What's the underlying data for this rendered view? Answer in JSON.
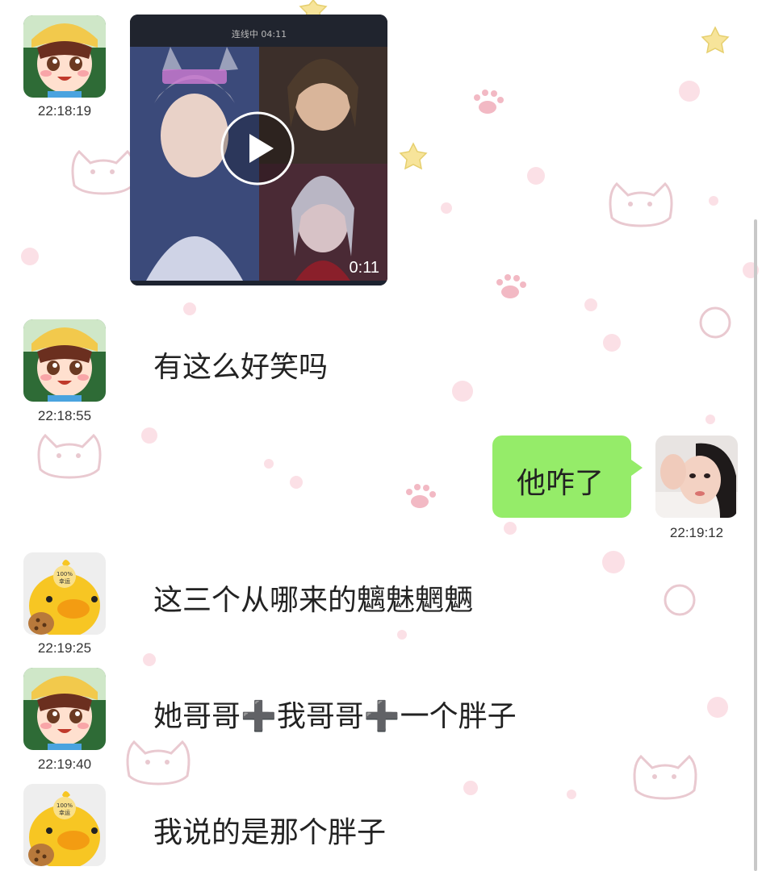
{
  "messages": [
    {
      "time": "22:18:19",
      "duration": "0:11",
      "live_status": "连线中 04:11"
    },
    {
      "time": "22:18:55",
      "text": "有这么好笑吗"
    },
    {
      "time": "22:19:12",
      "text": "他咋了"
    },
    {
      "time": "22:19:25",
      "text": "这三个从哪来的魑魅魍魉"
    },
    {
      "time": "22:19:40",
      "text": "她哥哥➕我哥哥➕一个胖子"
    },
    {
      "time": "",
      "text": "我说的是那个胖子"
    }
  ],
  "avatars": {
    "duck_badge_top": "100%",
    "duck_badge_bottom": "幸运"
  },
  "colors": {
    "self_bubble": "#95ec69",
    "decor_pink": "#f9d6de",
    "decor_yellow": "#f7e49a"
  }
}
